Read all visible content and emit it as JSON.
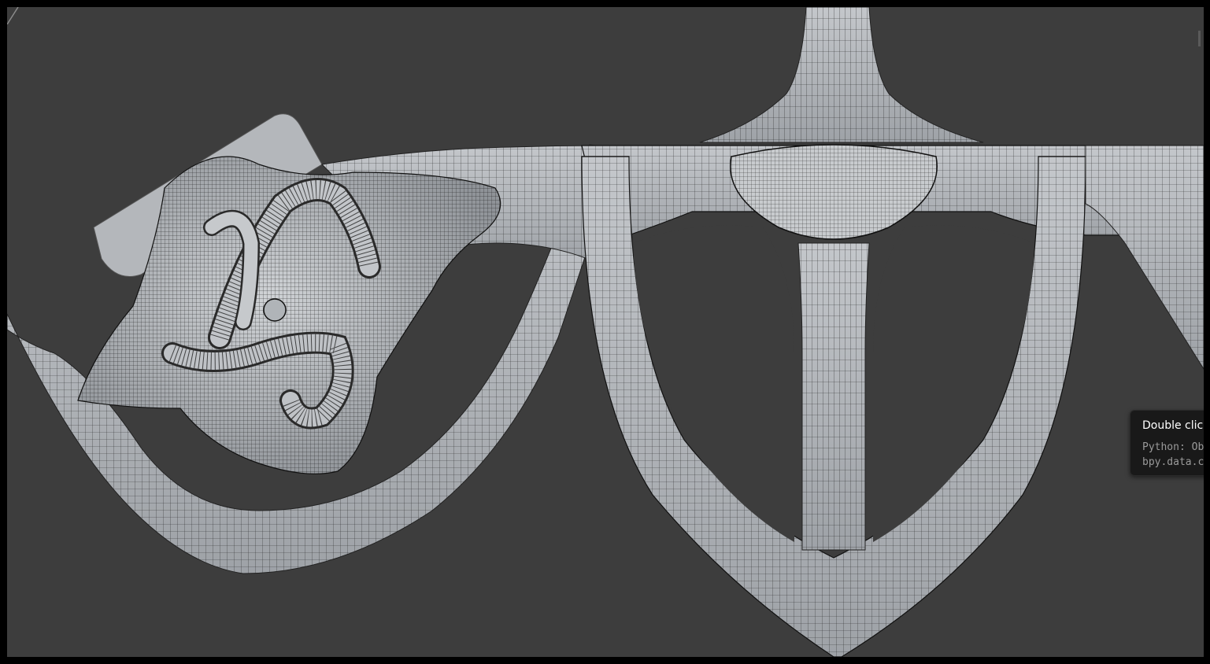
{
  "app": {
    "view": "3D Viewport",
    "shading": "wireframe overlay on solid"
  },
  "colors": {
    "background": "#3d3d3d",
    "mesh_fill": "#b9bcc0",
    "mesh_shadow": "#8e9297",
    "wire": "#1a1a1a",
    "tooltip_bg": "#191919",
    "tooltip_title": "#ffffff",
    "tooltip_text": "#9a9a9a"
  },
  "viewport": {
    "objects": [
      {
        "name": "ornament-knot-mesh",
        "description": "left ornamental knot"
      },
      {
        "name": "shield-frame-mesh",
        "description": "central shield-shaped frame"
      }
    ]
  },
  "tooltip": {
    "title": "Double click",
    "python_line1": "Python: Ob",
    "python_line2": "bpy.data.c"
  }
}
